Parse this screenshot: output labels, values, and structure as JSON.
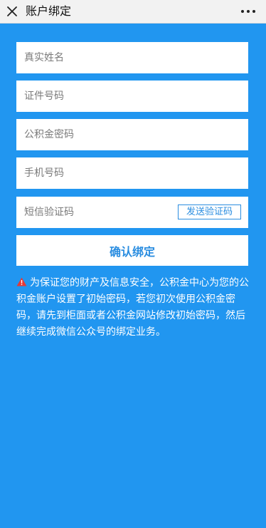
{
  "header": {
    "title": "账户绑定",
    "close_icon": "close-icon",
    "more_icon": "more-icon"
  },
  "form": {
    "real_name_placeholder": "真实姓名",
    "id_number_placeholder": "证件号码",
    "fund_password_placeholder": "公积金密码",
    "phone_placeholder": "手机号码",
    "sms_code_placeholder": "短信验证码",
    "send_code_label": "发送验证码",
    "confirm_label": "确认绑定"
  },
  "notice": {
    "icon": "warning-icon",
    "text": "为保证您的财产及信息安全，公积金中心为您的公积金账户设置了初始密码，若您初次使用公积金密码，请先到柜面或者公积金网站修改初始密码，然后继续完成微信公众号的绑定业务。"
  },
  "colors": {
    "background": "#2196f0",
    "accent": "#2a8de0",
    "warning": "#e53935",
    "topbar": "#f2f2f2"
  }
}
